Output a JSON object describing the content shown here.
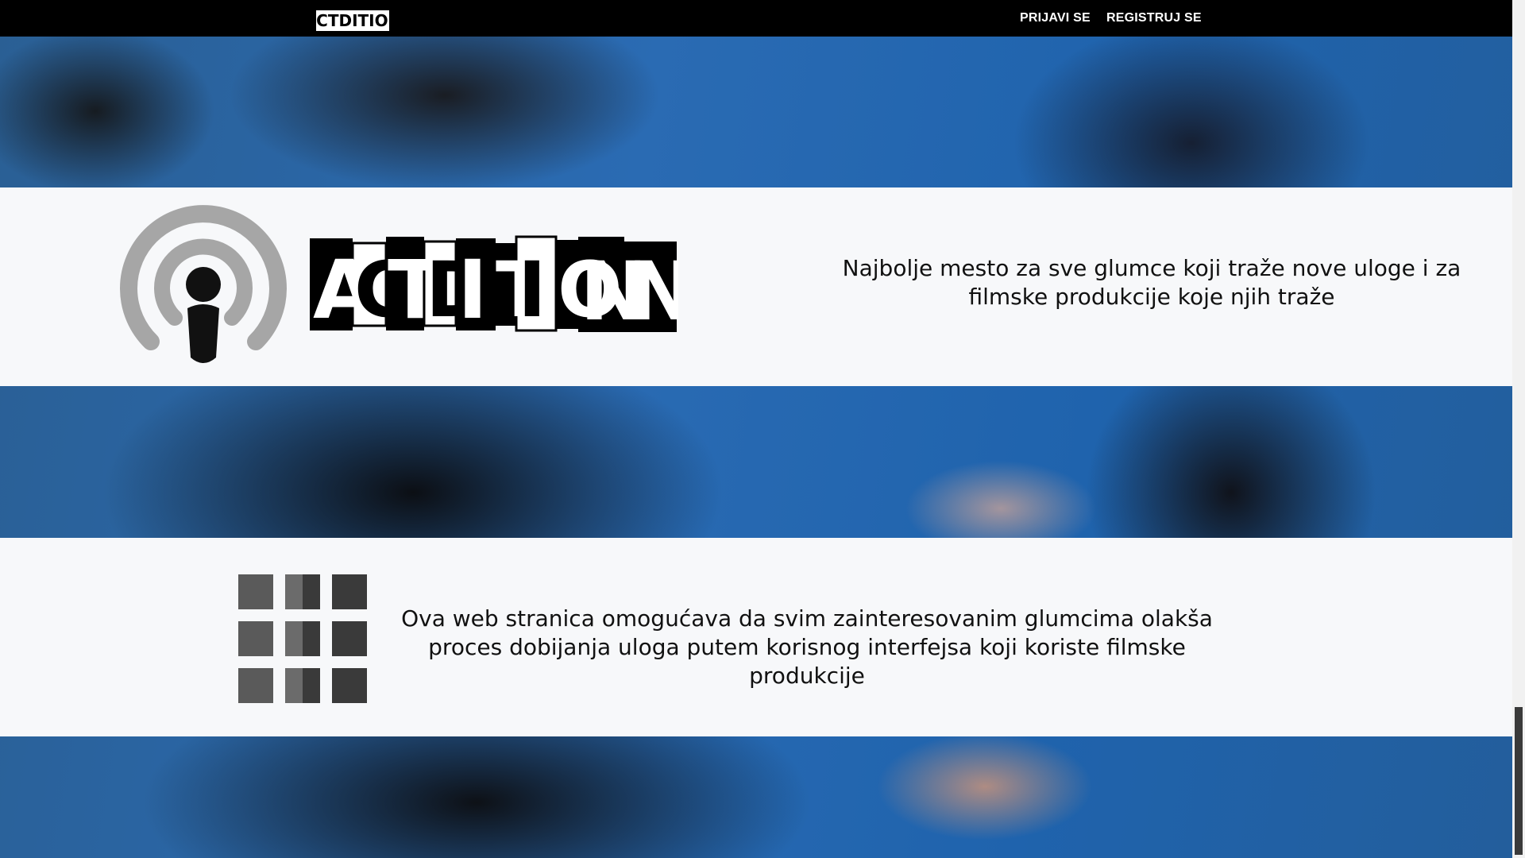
{
  "header": {
    "logo_text": "ACTDITION",
    "nav": {
      "login": "PRIJAVI SE",
      "register": "REGISTRUJ SE"
    }
  },
  "hero": {
    "logo_text": "ACTDITION",
    "tagline": "Najbolje mesto za sve glumce koji traže nove uloge i za filmske produkcije koje njih traže"
  },
  "about": {
    "description": "Ova web stranica omogućava da svim zainteresovanim glumcima olakša proces dobijanja uloga putem korisnog interfejsa koji koriste filmske produkcije"
  },
  "icons": {
    "podcast": "podcast-icon",
    "grid": "grid-icon"
  },
  "colors": {
    "topbar": "#000000",
    "band": "#f7f8fa",
    "icon_gray": "#a6a6a6",
    "grid_dark": "#3a3a3a",
    "grid_mid": "#5a5a5a"
  }
}
